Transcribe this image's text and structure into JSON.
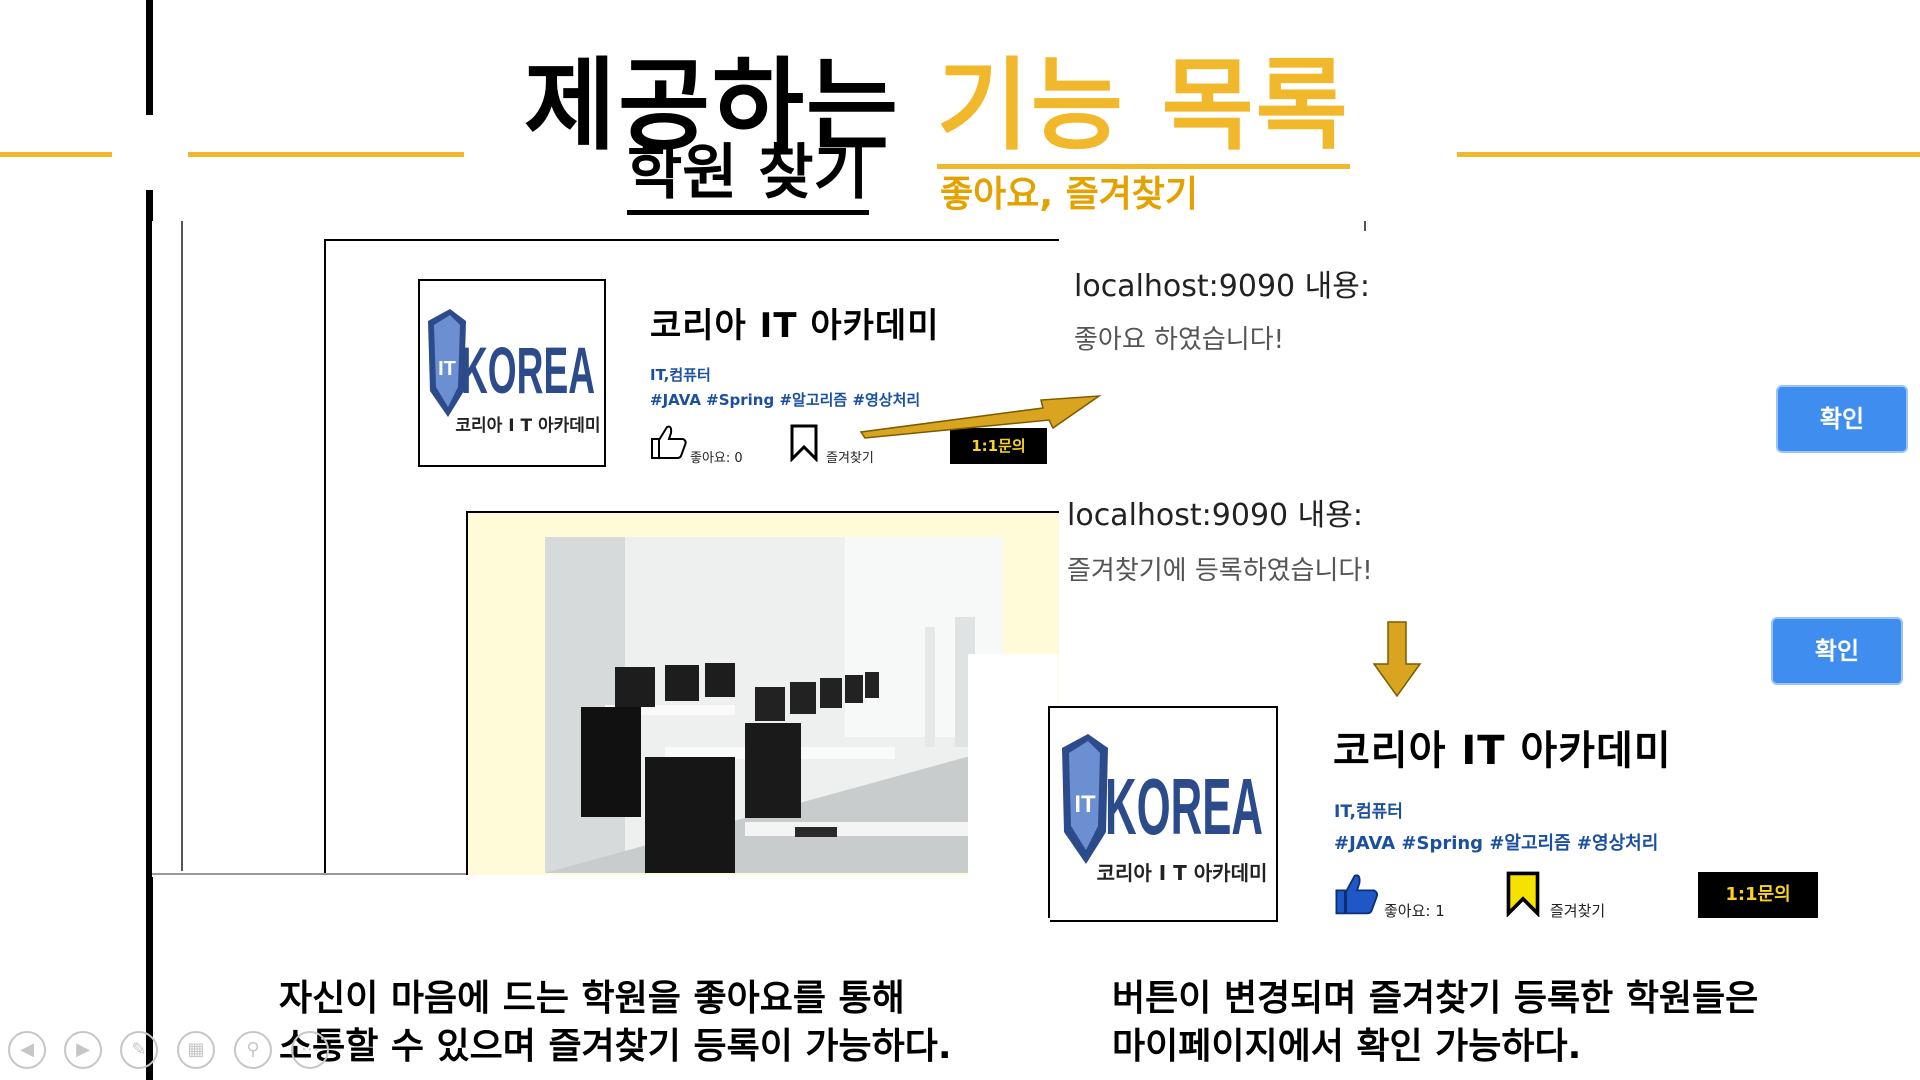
{
  "title": {
    "part1": "제공하는",
    "part2": "기능 목록"
  },
  "subtitle": {
    "main": "학원 찾기",
    "secondary": "좋아요, 즐겨찾기"
  },
  "academy": {
    "name": "코리아 IT 아카데미",
    "category": "IT,컴퓨터",
    "tags": "#JAVA #Spring #알고리즘 #영상처리",
    "logo_text": "KOREA",
    "logo_sub": "코리아 I T 아카데미",
    "logo_badge": "IT",
    "inquiry_label": "1:1문의",
    "bookmark_label": "즐겨찾기"
  },
  "before": {
    "like_label": "좋아요: 0",
    "like_icon": "thumbs-up-outline-icon",
    "bookmark_icon": "bookmark-outline-icon"
  },
  "after": {
    "like_label": "좋아요: 1",
    "like_icon": "thumbs-up-filled-icon",
    "bookmark_icon": "bookmark-filled-icon"
  },
  "dialogs": [
    {
      "title": "localhost:9090 내용:",
      "message": "좋아요 하였습니다!",
      "ok_label": "확인"
    },
    {
      "title": "localhost:9090 내용:",
      "message": "즐겨찾기에 등록하였습니다!",
      "ok_label": "확인"
    }
  ],
  "captions": {
    "left": [
      "자신이 마음에 드는 학원을 좋아요를 통해",
      "소통할 수 있으며 즐겨찾기 등록이 가능하다."
    ],
    "right": [
      "버튼이 변경되며 즐겨찾기 등록한 학원들은",
      "마이페이지에서 확인 가능하다."
    ]
  },
  "colors": {
    "accent": "#f0b82a",
    "button": "#3f8def",
    "tag": "#1b4fa0",
    "inquiry_text": "#f7d21f"
  },
  "toolbar_icons": [
    "previous-icon",
    "next-icon",
    "pen-icon",
    "slides-grid-icon",
    "zoom-icon",
    "more-icon"
  ]
}
